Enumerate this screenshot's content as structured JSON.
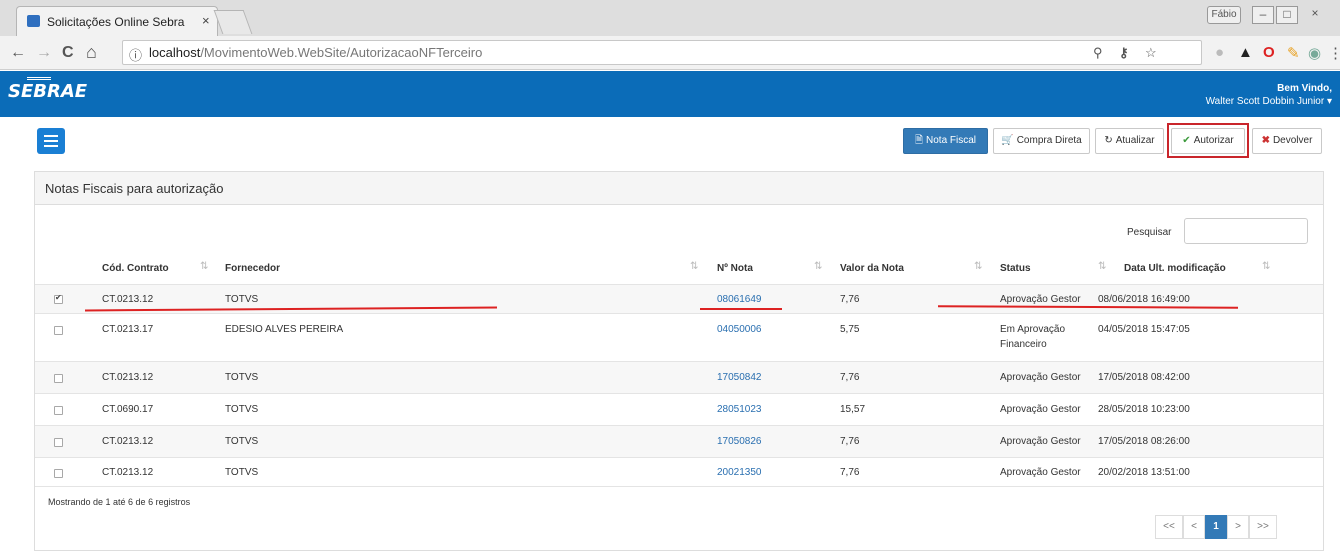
{
  "browser": {
    "tab_title": "Solicitações Online Sebra",
    "tab_close": "×",
    "profile": "Fábio",
    "win_min": "–",
    "win_max": "□",
    "win_close": "×",
    "back": "←",
    "forward": "→",
    "reload": "C",
    "home": "⌂",
    "url_host": "localhost",
    "url_path": "/MovimentoWeb.WebSite/AutorizacaoNFTerceiro",
    "menu": "⋮"
  },
  "header": {
    "logo": "SEBRAE",
    "welcome": "Bem Vindo,",
    "user": "Walter Scott Dobbin Junior"
  },
  "actions": {
    "nota_fiscal": "Nota Fiscal",
    "compra_direta": "Compra Direta",
    "atualizar": "Atualizar",
    "autorizar": "Autorizar",
    "devolver": "Devolver"
  },
  "panel": {
    "title": "Notas Fiscais para autorização",
    "search_label": "Pesquisar",
    "search_value": ""
  },
  "table": {
    "columns": [
      "Cód. Contrato",
      "Fornecedor",
      "Nº Nota",
      "Valor da Nota",
      "Status",
      "Data Ult. modificação"
    ],
    "rows": [
      {
        "checked": true,
        "contrato": "CT.0213.12",
        "fornecedor": "TOTVS",
        "nota": "08061649",
        "valor": "7,76",
        "status": "Aprovação Gestor",
        "status2": "",
        "data": "08/06/2018 16:49:00"
      },
      {
        "checked": false,
        "contrato": "CT.0213.17",
        "fornecedor": "EDESIO ALVES PEREIRA",
        "nota": "04050006",
        "valor": "5,75",
        "status": "Em Aprovação",
        "status2": "Financeiro",
        "data": "04/05/2018 15:47:05"
      },
      {
        "checked": false,
        "contrato": "CT.0213.12",
        "fornecedor": "TOTVS",
        "nota": "17050842",
        "valor": "7,76",
        "status": "Aprovação Gestor",
        "status2": "",
        "data": "17/05/2018 08:42:00"
      },
      {
        "checked": false,
        "contrato": "CT.0690.17",
        "fornecedor": "TOTVS",
        "nota": "28051023",
        "valor": "15,57",
        "status": "Aprovação Gestor",
        "status2": "",
        "data": "28/05/2018 10:23:00"
      },
      {
        "checked": false,
        "contrato": "CT.0213.12",
        "fornecedor": "TOTVS",
        "nota": "17050826",
        "valor": "7,76",
        "status": "Aprovação Gestor",
        "status2": "",
        "data": "17/05/2018 08:26:00"
      },
      {
        "checked": false,
        "contrato": "CT.0213.12",
        "fornecedor": "TOTVS",
        "nota": "20021350",
        "valor": "7,76",
        "status": "Aprovação Gestor",
        "status2": "",
        "data": "20/02/2018 13:51:00"
      }
    ],
    "info": "Mostrando de 1 até 6 de 6 registros"
  },
  "pagination": {
    "first": "<<",
    "prev": "<",
    "current": "1",
    "next": ">",
    "last": ">>"
  },
  "colors": {
    "appbar": "#0b6cb8",
    "primary": "#337ab7",
    "link": "#2a6fb0",
    "highlight": "#c9252b"
  }
}
